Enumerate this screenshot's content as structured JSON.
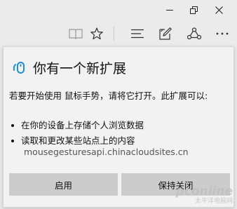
{
  "window": {
    "controls": {
      "minimize_icon": "minimize-icon",
      "restore_icon": "restore-icon",
      "close_icon": "close-icon"
    }
  },
  "toolbar": {
    "icons": [
      "reading-view-icon",
      "favorite-star-icon",
      "hub-icon",
      "web-note-icon",
      "share-icon",
      "more-icon"
    ]
  },
  "popup": {
    "title": "你有一个新扩展",
    "description": "若要开始使用 鼠标手势，请将它打开。此扩展可以:",
    "permissions": [
      "在你的设备上存储个人浏览数据",
      "读取和更改某些站点上的内容"
    ],
    "site": "mousegesturesapi.chinacloudsites.cn",
    "buttons": {
      "enable": "启用",
      "keep_off": "保持关闭"
    }
  },
  "watermark": {
    "line1": "pconline",
    "line2": "太平洋电脑网"
  },
  "colors": {
    "background": "#ebebeb",
    "popup_bg": "#f2f2f2",
    "button_bg": "#cccccc",
    "ext_icon_blue": "#1f8fd6"
  }
}
